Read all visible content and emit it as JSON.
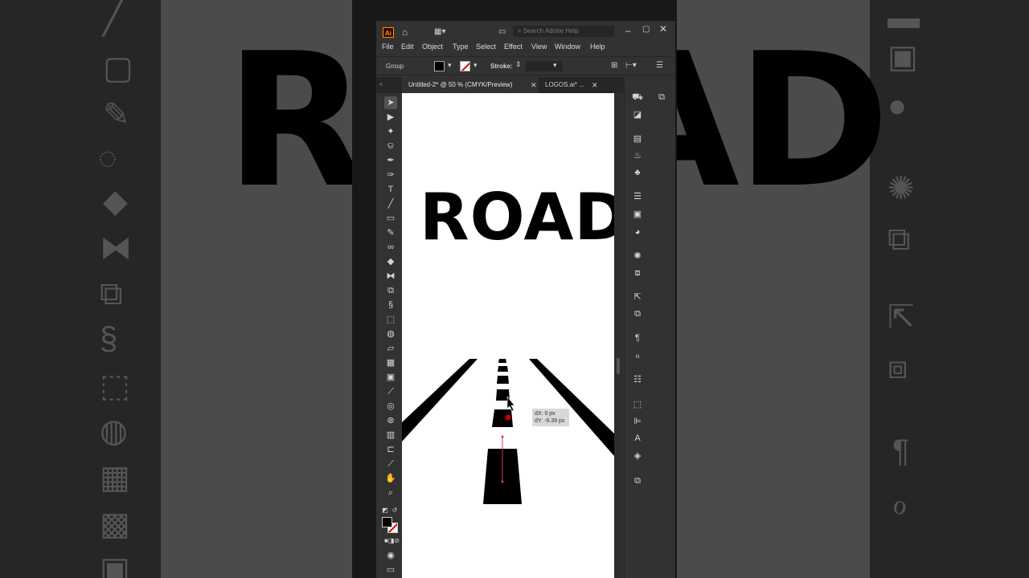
{
  "app": {
    "logo": "Ai",
    "search_placeholder": "Search Adobe Help",
    "window_controls": [
      "minimize-icon",
      "maximize-icon",
      "close-icon"
    ]
  },
  "menu": [
    "File",
    "Edit",
    "Object",
    "Type",
    "Select",
    "Effect",
    "View",
    "Window",
    "Help"
  ],
  "control_bar": {
    "selection": "Group",
    "stroke_label": "Stroke:"
  },
  "tabs": [
    {
      "label": "Untitled-2* @ 50 % (CMYK/Preview)",
      "active": true
    },
    {
      "label": "LOGOS.ai* ...",
      "active": false
    }
  ],
  "artboard": {
    "title_text": "ROAD"
  },
  "tooltip": {
    "dx": "dX: 0 px",
    "dy": "dY: -9.39 px"
  },
  "colors": {
    "background": "#181818",
    "ui_panel": "#323232",
    "canvas": "#535353",
    "artboard": "#ffffff",
    "accent_red": "#cc0000"
  },
  "tools": [
    "selection-tool-icon",
    "direct-selection-tool-icon",
    "magic-wand-tool-icon",
    "lasso-tool-icon",
    "pen-tool-icon",
    "curvature-tool-icon",
    "type-tool-icon",
    "line-tool-icon",
    "rectangle-tool-icon",
    "paintbrush-tool-icon",
    "shaper-tool-icon",
    "eraser-tool-icon",
    "reflect-tool-icon",
    "scale-tool-icon",
    "warp-tool-icon",
    "free-transform-tool-icon",
    "shape-builder-tool-icon",
    "perspective-grid-tool-icon",
    "mesh-tool-icon",
    "gradient-tool-icon",
    "eyedropper-tool-icon",
    "blend-tool-icon",
    "symbol-sprayer-tool-icon",
    "column-graph-tool-icon",
    "artboard-tool-icon",
    "slice-tool-icon",
    "hand-tool-icon",
    "zoom-tool-icon"
  ]
}
